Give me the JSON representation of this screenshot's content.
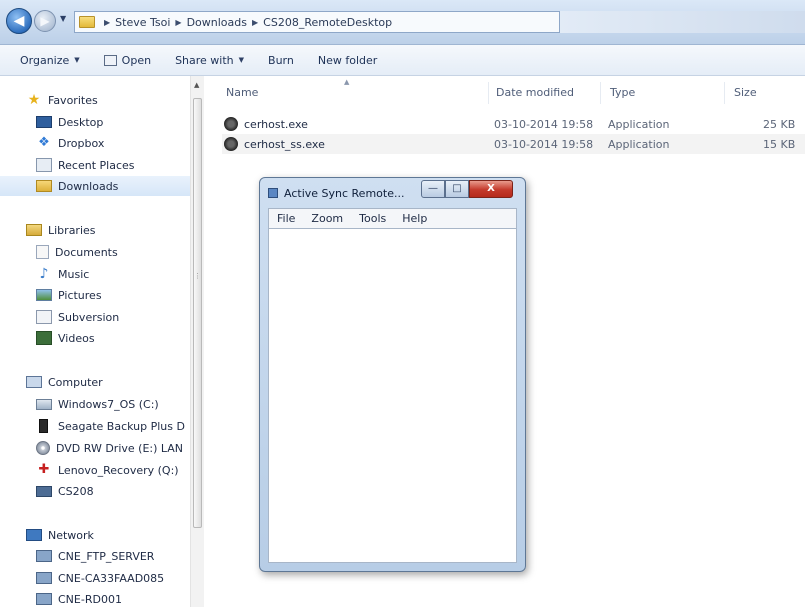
{
  "address": {
    "breadcrumbs": [
      "Steve Tsoi",
      "Downloads",
      "CS208_RemoteDesktop"
    ]
  },
  "toolbar": {
    "organize": "Organize",
    "open": "Open",
    "share_with": "Share with",
    "burn": "Burn",
    "new_folder": "New folder"
  },
  "nav": {
    "favorites": "Favorites",
    "desktop": "Desktop",
    "dropbox": "Dropbox",
    "recent_places": "Recent Places",
    "downloads": "Downloads",
    "libraries": "Libraries",
    "documents": "Documents",
    "music": "Music",
    "pictures": "Pictures",
    "subversion": "Subversion",
    "videos": "Videos",
    "computer": "Computer",
    "windows7_os": "Windows7_OS (C:)",
    "seagate": "Seagate Backup Plus D",
    "dvd": "DVD RW Drive (E:) LAN",
    "lenovo_recovery": "Lenovo_Recovery (Q:)",
    "cs208": "CS208",
    "network": "Network",
    "net_items": [
      "CNE_FTP_SERVER",
      "CNE-CA33FAAD085",
      "CNE-RD001"
    ]
  },
  "columns": {
    "name": "Name",
    "date_modified": "Date modified",
    "type": "Type",
    "size": "Size"
  },
  "files": [
    {
      "name": "cerhost.exe",
      "date": "03-10-2014 19:58",
      "type": "Application",
      "size": "25 KB"
    },
    {
      "name": "cerhost_ss.exe",
      "date": "03-10-2014 19:58",
      "type": "Application",
      "size": "15 KB"
    }
  ],
  "window": {
    "title": "Active Sync Remote...",
    "menu": [
      "File",
      "Zoom",
      "Tools",
      "Help"
    ],
    "min": "—",
    "max": "□",
    "close": "X"
  },
  "colors": {
    "accent": "#2f6fbe",
    "selected_row": "#d6e6f8",
    "close_button": "#c4392b"
  }
}
